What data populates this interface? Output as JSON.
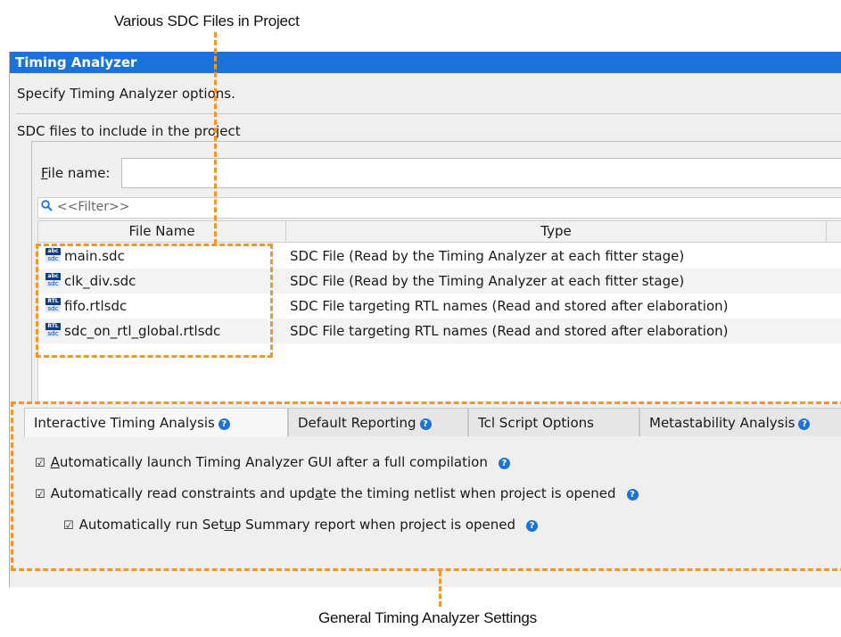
{
  "callouts": {
    "top": "Various SDC Files in Project",
    "bottom": "General Timing Analyzer Settings"
  },
  "panel": {
    "title": "Timing Analyzer",
    "description": "Specify Timing Analyzer options.",
    "section_label": "SDC files to include in the project",
    "file_name_label": "File name:",
    "file_name_value": "",
    "filter_placeholder": "<<Filter>>",
    "table": {
      "columns": [
        "File Name",
        "Type"
      ],
      "rows": [
        {
          "name": "main.sdc",
          "type": "SDC File (Read by the Timing Analyzer at each fitter stage)",
          "icon_top": "abc",
          "icon_bottom": "sdc"
        },
        {
          "name": "clk_div.sdc",
          "type": "SDC File (Read by the Timing Analyzer at each fitter stage)",
          "icon_top": "abc",
          "icon_bottom": "sdc"
        },
        {
          "name": "fifo.rtlsdc",
          "type": "SDC File targeting RTL names (Read and stored after elaboration)",
          "icon_top": "RTL",
          "icon_bottom": "sdc"
        },
        {
          "name": "sdc_on_rtl_global.rtlsdc",
          "type": "SDC File targeting RTL names (Read and stored after elaboration)",
          "icon_top": "RTL",
          "icon_bottom": "sdc"
        }
      ]
    },
    "tabs": [
      {
        "label": "Interactive Timing Analysis",
        "help": true,
        "active": true
      },
      {
        "label": "Default Reporting",
        "help": true,
        "active": false
      },
      {
        "label": "Tcl Script Options",
        "help": false,
        "active": false
      },
      {
        "label": "Metastability Analysis",
        "help": true,
        "active": false
      }
    ],
    "options": [
      {
        "label": "Automatically launch Timing Analyzer GUI after a full compilation",
        "checked": true
      },
      {
        "label": "Automatically read constraints and update the timing netlist when project is opened",
        "checked": true
      },
      {
        "label": "Automatically run Setup Summary report when project is opened",
        "checked": true
      }
    ],
    "check_mark": "☑",
    "help_mark": "?"
  },
  "colors": {
    "titlebar": "#1a73d9",
    "callout_dash": "#f0962b",
    "help_icon": "#1a73d9"
  }
}
